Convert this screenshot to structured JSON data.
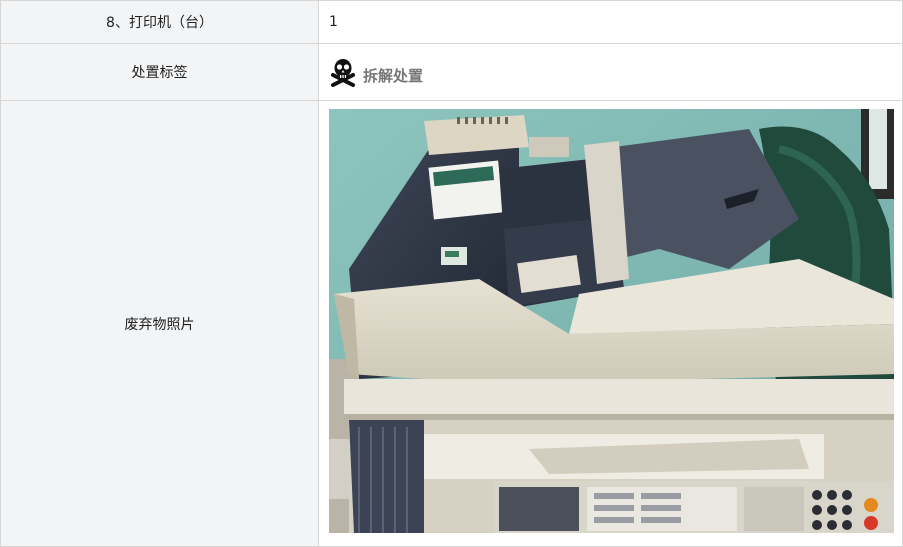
{
  "rows": [
    {
      "label": "8、打印机（台）",
      "value": "1"
    },
    {
      "label": "处置标签",
      "tag": {
        "icon": "skull-crossbones-icon",
        "text": "拆解处置"
      }
    },
    {
      "label": "废弃物照片",
      "photo_subject": "discarded printer / copier photo"
    }
  ]
}
